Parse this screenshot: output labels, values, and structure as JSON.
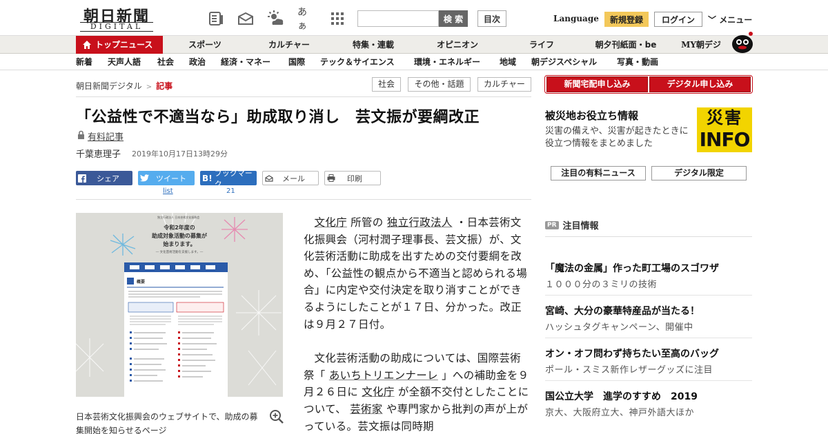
{
  "header": {
    "logo_jp": "朝日新聞",
    "logo_en": "DIGITAL",
    "icons": [
      "newspaper-icon",
      "mail-open-icon",
      "weather-icon",
      "font-size-icon",
      "grid-menu-icon"
    ],
    "font_icon_text": "あぁ",
    "search_placeholder": "",
    "search_label": "検 索",
    "toc_label": "目次",
    "language_label": "Language",
    "register_label": "新規登録",
    "login_label": "ログイン",
    "menu_label": "メニュー"
  },
  "nav_main": {
    "active": "トップニュース",
    "items": [
      "スポーツ",
      "カルチャー",
      "特集・連載",
      "オピニオン",
      "ライフ",
      "朝夕刊紙面・be",
      "MY朝デジ"
    ]
  },
  "nav_sub": {
    "items": [
      "新着",
      "天声人語",
      "社会",
      "政治",
      "経済・マネー",
      "国際",
      "テック＆サイエンス",
      "環境・エネルギー",
      "地域",
      "朝デジスペシャル",
      "写真・動画"
    ]
  },
  "breadcrumb": {
    "home": "朝日新聞デジタル",
    "separator": ">",
    "current": "記事"
  },
  "tags": [
    "社会",
    "その他・話題",
    "カルチャー"
  ],
  "article": {
    "title": "「公益性で不適当なら」助成取り消し　芸文振が要綱改正",
    "paid_label": "有料記事",
    "author": "千葉恵理子",
    "date": "2019年10月17日13時29分",
    "share": {
      "facebook": "シェア",
      "twitter": "ツイート",
      "twitter_count": "list",
      "hatena": "ブックマーク",
      "hatena_icon": "B!",
      "hatena_count": "21",
      "mail": "メール",
      "print": "印刷"
    },
    "image_caption": "日本芸術文化振興会のウェブサイトで、助成の募集開始を知らせるページ",
    "photo_text": {
      "org": "独立行政法人 日本芸術文化振興会",
      "headline1": "令和2年度の",
      "headline2": "助成対象活動の募集が",
      "headline3": "始まります。",
      "sub": "― 文化芸術活動を支援します。―",
      "section": "概要"
    },
    "p1": {
      "a": "文化庁",
      "b": " 所管の ",
      "c": "独立行政法人",
      "d": " ・日本芸術文化振興会（河村潤子理事長、芸文振）が、文化芸術活動に助成を出すための交付要綱を改め、「公益性の観点から不適当と認められる場合」に内定や交付決定を取り消すことができるようにしたことが１７日、分かった。改正は９月２７日付。"
    },
    "p2": {
      "a": "文化芸術活動の助成については、国際芸術祭「 ",
      "b": "あいちトリエンナーレ",
      "c": " 」への補助金を９月２６日に ",
      "d": "文化庁",
      "e": " が全額不交付としたことについて、 ",
      "f": "芸術家",
      "g": " や専門家から批判の声が上がっている。芸文振は同時期"
    }
  },
  "sidebar": {
    "delivery_button": "新聞宅配申し込み",
    "digital_button": "デジタル申し込み",
    "disaster": {
      "title": "被災地お役立ち情報",
      "desc": "災害の備えや、災害が起きたときに役立つ情報をまとめました",
      "badge_top": "災害",
      "badge_bottom": "INFO"
    },
    "tabs": [
      "注目の有料ニュース",
      "デジタル限定"
    ],
    "pr_badge": "PR",
    "pr_heading": "注目情報",
    "pr_items": [
      {
        "title": "「魔法の金属」作った町工場のスゴワザ",
        "sub": "１０００分の３ミリの技術"
      },
      {
        "title": "宮崎、大分の豪華特産品が当たる！",
        "sub": "ハッシュタグキャンペーン、開催中"
      },
      {
        "title": "オン・オフ問わず持ちたい至高のバッグ",
        "sub": "ポール・スミス新作レザーグッズに注目"
      },
      {
        "title": "国公立大学　進学のすすめ　2019",
        "sub": "京大、大阪府立大、神戸外語大ほか"
      }
    ]
  },
  "colors": {
    "brand_red": "#c8101b",
    "register_yellow": "#f3c85a",
    "facebook": "#3b5998",
    "twitter": "#55acee",
    "hatena": "#2c6ebd",
    "disaster_yellow": "#f2d400"
  }
}
